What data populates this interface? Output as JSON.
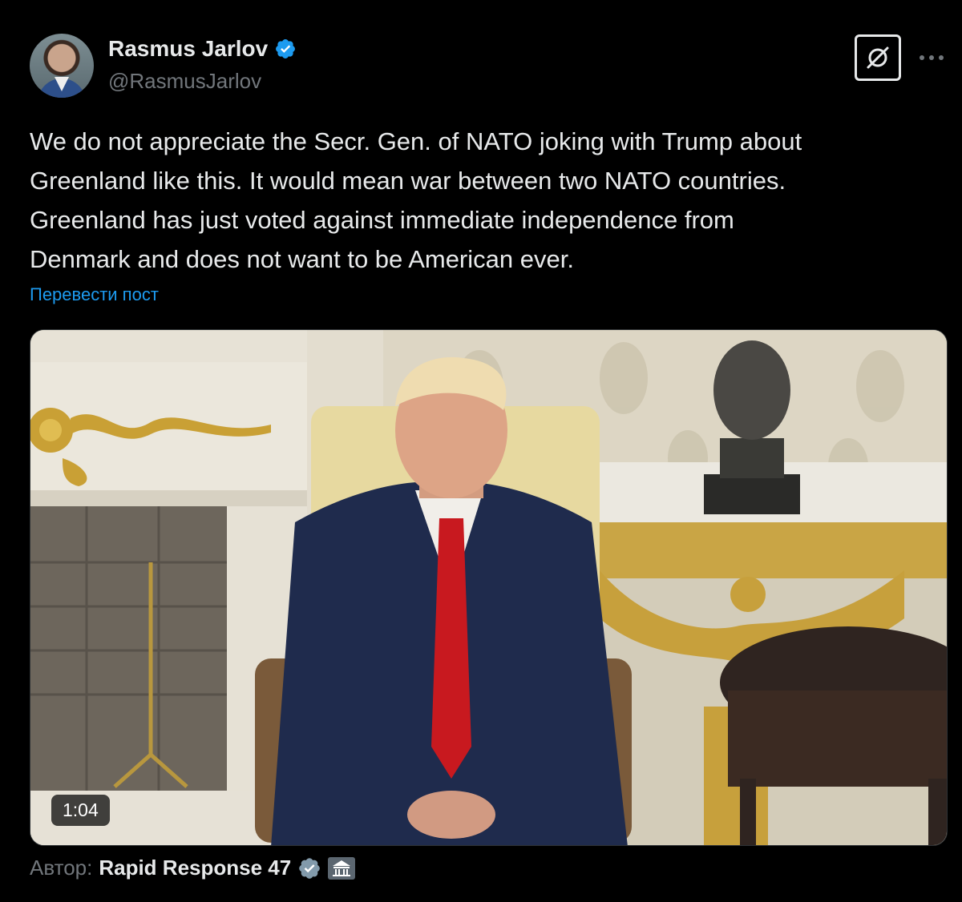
{
  "author": {
    "name": "Rasmus Jarlov",
    "handle": "@RasmusJarlov",
    "verified": true,
    "badge_color": "#1d9bf0"
  },
  "actions": {
    "grok_icon": "grok-icon",
    "more_icon": "more-icon"
  },
  "post": {
    "text": "We do not appreciate the Secr. Gen. of NATO joking with Trump about\nGreenland like this. It would mean war between two NATO countries.\nGreenland has just voted against immediate independence from\nDenmark and does not want to be American ever.",
    "translate_label": "Перевести пост"
  },
  "media": {
    "type": "video",
    "duration": "1:04"
  },
  "source": {
    "prefix": "Автор:",
    "name": "Rapid Response 47",
    "verified_color": "#829aab",
    "affiliation_icon": "government-building-icon"
  },
  "colors": {
    "background": "#000000",
    "text": "#e7e9ea",
    "secondary": "#71767b",
    "link": "#1d9bf0"
  }
}
